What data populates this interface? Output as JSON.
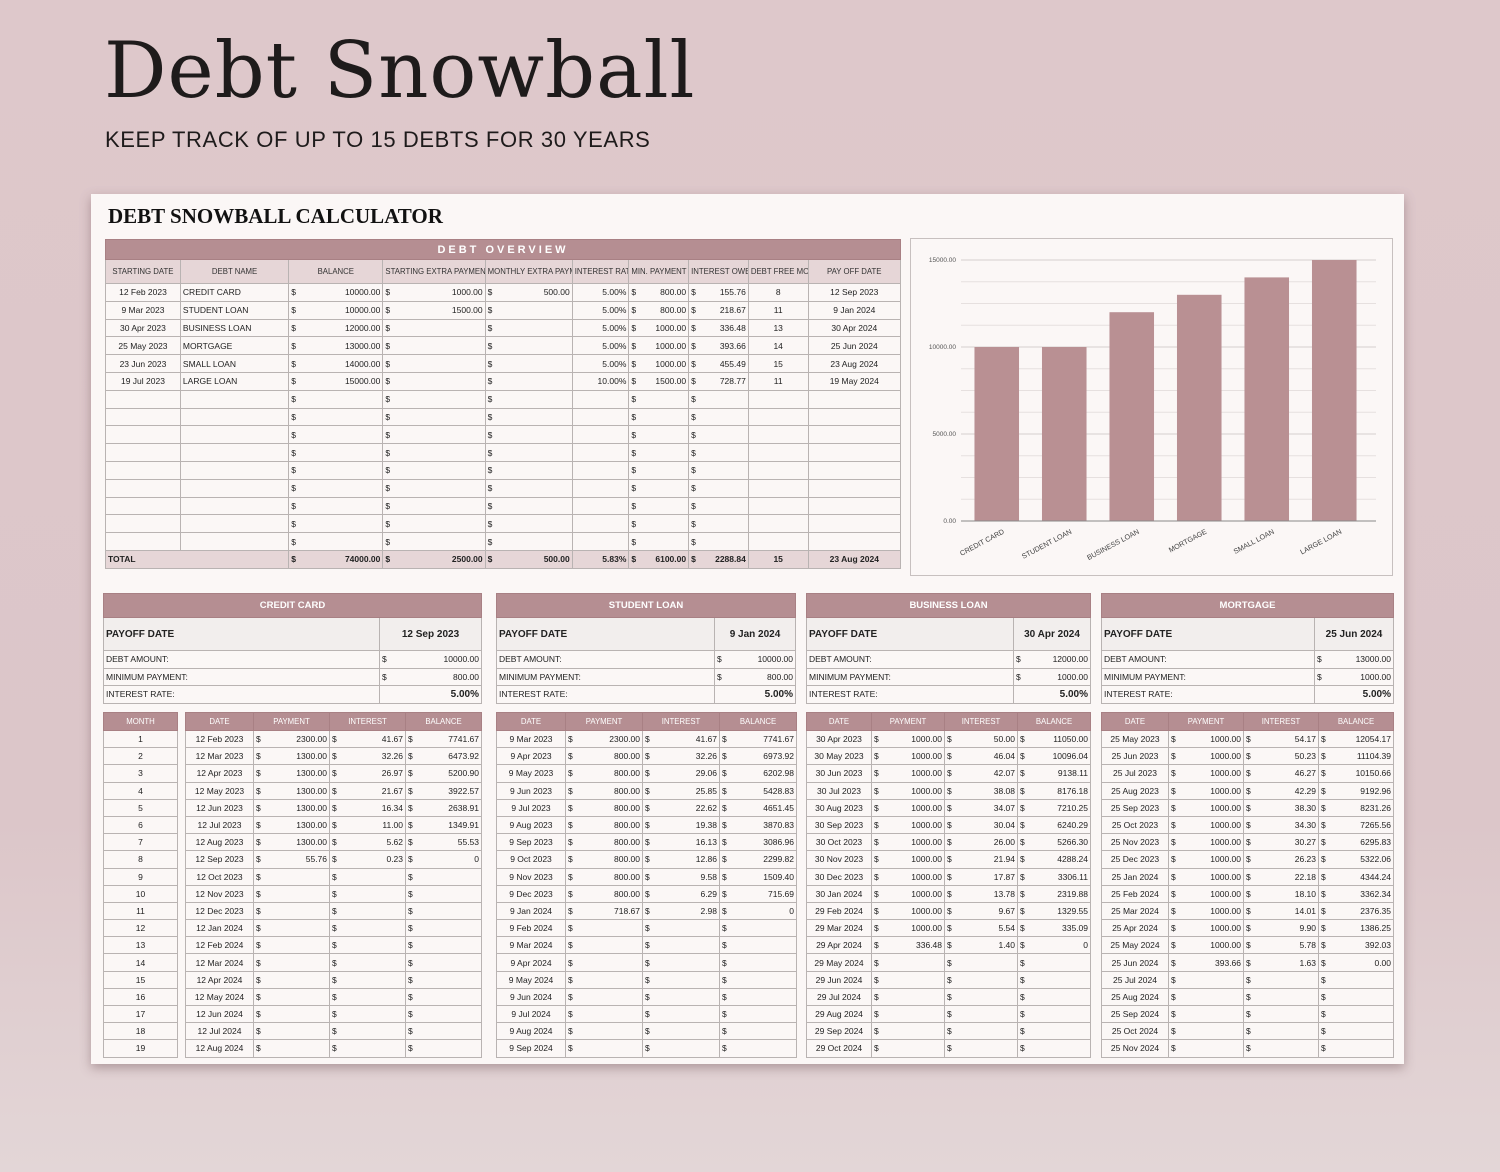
{
  "hero": {
    "title": "Debt Snowball",
    "subtitle": "KEEP TRACK OF UP TO 15 DEBTS FOR 30 YEARS"
  },
  "sheet": {
    "title": "DEBT SNOWBALL CALCULATOR",
    "accent_color": "#b58e92",
    "header_bg_color": "#e6d6d7"
  },
  "overview": {
    "band": "DEBT OVERVIEW",
    "headers": [
      "STARTING DATE",
      "DEBT NAME",
      "BALANCE",
      "STARTING EXTRA PAYMENT",
      "MONTHLY EXTRA PAYMENT",
      "INTEREST RATE",
      "MIN. PAYMENT",
      "INTEREST OWED",
      "DEBT FREE MONTH",
      "PAY OFF DATE"
    ],
    "currency": "$",
    "rows": [
      {
        "start": "12 Feb 2023",
        "name": "CREDIT CARD",
        "balance": "10000.00",
        "start_extra": "1000.00",
        "monthly_extra": "500.00",
        "rate": "5.00%",
        "min": "800.00",
        "interest": "155.76",
        "month": "8",
        "payoff": "12 Sep 2023"
      },
      {
        "start": "9 Mar 2023",
        "name": "STUDENT LOAN",
        "balance": "10000.00",
        "start_extra": "1500.00",
        "monthly_extra": "",
        "rate": "5.00%",
        "min": "800.00",
        "interest": "218.67",
        "month": "11",
        "payoff": "9 Jan 2024"
      },
      {
        "start": "30 Apr 2023",
        "name": "BUSINESS LOAN",
        "balance": "12000.00",
        "start_extra": "",
        "monthly_extra": "",
        "rate": "5.00%",
        "min": "1000.00",
        "interest": "336.48",
        "month": "13",
        "payoff": "30 Apr 2024"
      },
      {
        "start": "25 May 2023",
        "name": "MORTGAGE",
        "balance": "13000.00",
        "start_extra": "",
        "monthly_extra": "",
        "rate": "5.00%",
        "min": "1000.00",
        "interest": "393.66",
        "month": "14",
        "payoff": "25 Jun 2024"
      },
      {
        "start": "23 Jun 2023",
        "name": "SMALL LOAN",
        "balance": "14000.00",
        "start_extra": "",
        "monthly_extra": "",
        "rate": "5.00%",
        "min": "1000.00",
        "interest": "455.49",
        "month": "15",
        "payoff": "23 Aug 2024"
      },
      {
        "start": "19 Jul 2023",
        "name": "LARGE LOAN",
        "balance": "15000.00",
        "start_extra": "",
        "monthly_extra": "",
        "rate": "10.00%",
        "min": "1500.00",
        "interest": "728.77",
        "month": "11",
        "payoff": "19 May 2024"
      }
    ],
    "empty_rows": 9,
    "total": {
      "label": "TOTAL",
      "balance": "74000.00",
      "start_extra": "2500.00",
      "monthly_extra": "500.00",
      "rate": "5.83%",
      "min": "6100.00",
      "interest": "2288.84",
      "month": "15",
      "payoff": "23 Aug 2024"
    }
  },
  "chart_data": {
    "type": "bar",
    "title": "",
    "xlabel": "",
    "ylabel": "",
    "categories": [
      "CREDIT CARD",
      "STUDENT LOAN",
      "BUSINESS LOAN",
      "MORTGAGE",
      "SMALL LOAN",
      "LARGE LOAN"
    ],
    "values": [
      10000,
      10000,
      12000,
      13000,
      14000,
      15000
    ],
    "ylim": [
      0,
      15000
    ],
    "yticks": [
      "0.00",
      "5000.00",
      "10000.00",
      "15000.00"
    ],
    "grid": true,
    "bar_color": "#b99093"
  },
  "month_column": {
    "header": "MONTH",
    "values": [
      "1",
      "2",
      "3",
      "4",
      "5",
      "6",
      "7",
      "8",
      "9",
      "10",
      "11",
      "12",
      "13",
      "14",
      "15",
      "16",
      "17",
      "18",
      "19"
    ]
  },
  "debts": [
    {
      "name": "CREDIT CARD",
      "payoff_label": "PAYOFF DATE",
      "payoff": "12 Sep 2023",
      "amount_label": "DEBT AMOUNT:",
      "amount": "10000.00",
      "min_label": "MINIMUM PAYMENT:",
      "min": "800.00",
      "rate_label": "INTEREST RATE:",
      "rate": "5.00%",
      "schedule_headers": [
        "DATE",
        "PAYMENT",
        "INTEREST",
        "BALANCE"
      ],
      "schedule": [
        [
          "12 Feb 2023",
          "2300.00",
          "41.67",
          "7741.67"
        ],
        [
          "12 Mar 2023",
          "1300.00",
          "32.26",
          "6473.92"
        ],
        [
          "12 Apr 2023",
          "1300.00",
          "26.97",
          "5200.90"
        ],
        [
          "12 May 2023",
          "1300.00",
          "21.67",
          "3922.57"
        ],
        [
          "12 Jun 2023",
          "1300.00",
          "16.34",
          "2638.91"
        ],
        [
          "12 Jul 2023",
          "1300.00",
          "11.00",
          "1349.91"
        ],
        [
          "12 Aug 2023",
          "1300.00",
          "5.62",
          "55.53"
        ],
        [
          "12 Sep 2023",
          "55.76",
          "0.23",
          "0"
        ],
        [
          "12 Oct 2023",
          "",
          "",
          ""
        ],
        [
          "12 Nov 2023",
          "",
          "",
          ""
        ],
        [
          "12 Dec 2023",
          "",
          "",
          ""
        ],
        [
          "12 Jan 2024",
          "",
          "",
          ""
        ],
        [
          "12 Feb 2024",
          "",
          "",
          ""
        ],
        [
          "12 Mar 2024",
          "",
          "",
          ""
        ],
        [
          "12 Apr 2024",
          "",
          "",
          ""
        ],
        [
          "12 May 2024",
          "",
          "",
          ""
        ],
        [
          "12 Jun 2024",
          "",
          "",
          ""
        ],
        [
          "12 Jul 2024",
          "",
          "",
          ""
        ],
        [
          "12 Aug 2024",
          "",
          "",
          ""
        ]
      ]
    },
    {
      "name": "STUDENT LOAN",
      "payoff_label": "PAYOFF DATE",
      "payoff": "9 Jan 2024",
      "amount_label": "DEBT AMOUNT:",
      "amount": "10000.00",
      "min_label": "MINIMUM PAYMENT:",
      "min": "800.00",
      "rate_label": "INTEREST RATE:",
      "rate": "5.00%",
      "schedule_headers": [
        "DATE",
        "PAYMENT",
        "INTEREST",
        "BALANCE"
      ],
      "schedule": [
        [
          "9 Mar 2023",
          "2300.00",
          "41.67",
          "7741.67"
        ],
        [
          "9 Apr 2023",
          "800.00",
          "32.26",
          "6973.92"
        ],
        [
          "9 May 2023",
          "800.00",
          "29.06",
          "6202.98"
        ],
        [
          "9 Jun 2023",
          "800.00",
          "25.85",
          "5428.83"
        ],
        [
          "9 Jul 2023",
          "800.00",
          "22.62",
          "4651.45"
        ],
        [
          "9 Aug 2023",
          "800.00",
          "19.38",
          "3870.83"
        ],
        [
          "9 Sep 2023",
          "800.00",
          "16.13",
          "3086.96"
        ],
        [
          "9 Oct 2023",
          "800.00",
          "12.86",
          "2299.82"
        ],
        [
          "9 Nov 2023",
          "800.00",
          "9.58",
          "1509.40"
        ],
        [
          "9 Dec 2023",
          "800.00",
          "6.29",
          "715.69"
        ],
        [
          "9 Jan 2024",
          "718.67",
          "2.98",
          "0"
        ],
        [
          "9 Feb 2024",
          "",
          "",
          ""
        ],
        [
          "9 Mar 2024",
          "",
          "",
          ""
        ],
        [
          "9 Apr 2024",
          "",
          "",
          ""
        ],
        [
          "9 May 2024",
          "",
          "",
          ""
        ],
        [
          "9 Jun 2024",
          "",
          "",
          ""
        ],
        [
          "9 Jul 2024",
          "",
          "",
          ""
        ],
        [
          "9 Aug 2024",
          "",
          "",
          ""
        ],
        [
          "9 Sep 2024",
          "",
          "",
          ""
        ]
      ]
    },
    {
      "name": "BUSINESS LOAN",
      "payoff_label": "PAYOFF DATE",
      "payoff": "30 Apr 2024",
      "amount_label": "DEBT AMOUNT:",
      "amount": "12000.00",
      "min_label": "MINIMUM PAYMENT:",
      "min": "1000.00",
      "rate_label": "INTEREST RATE:",
      "rate": "5.00%",
      "schedule_headers": [
        "DATE",
        "PAYMENT",
        "INTEREST",
        "BALANCE"
      ],
      "schedule": [
        [
          "30 Apr 2023",
          "1000.00",
          "50.00",
          "11050.00"
        ],
        [
          "30 May 2023",
          "1000.00",
          "46.04",
          "10096.04"
        ],
        [
          "30 Jun 2023",
          "1000.00",
          "42.07",
          "9138.11"
        ],
        [
          "30 Jul 2023",
          "1000.00",
          "38.08",
          "8176.18"
        ],
        [
          "30 Aug 2023",
          "1000.00",
          "34.07",
          "7210.25"
        ],
        [
          "30 Sep 2023",
          "1000.00",
          "30.04",
          "6240.29"
        ],
        [
          "30 Oct 2023",
          "1000.00",
          "26.00",
          "5266.30"
        ],
        [
          "30 Nov 2023",
          "1000.00",
          "21.94",
          "4288.24"
        ],
        [
          "30 Dec 2023",
          "1000.00",
          "17.87",
          "3306.11"
        ],
        [
          "30 Jan 2024",
          "1000.00",
          "13.78",
          "2319.88"
        ],
        [
          "29 Feb 2024",
          "1000.00",
          "9.67",
          "1329.55"
        ],
        [
          "29 Mar 2024",
          "1000.00",
          "5.54",
          "335.09"
        ],
        [
          "29 Apr 2024",
          "336.48",
          "1.40",
          "0"
        ],
        [
          "29 May 2024",
          "",
          "",
          ""
        ],
        [
          "29 Jun 2024",
          "",
          "",
          ""
        ],
        [
          "29 Jul 2024",
          "",
          "",
          ""
        ],
        [
          "29 Aug 2024",
          "",
          "",
          ""
        ],
        [
          "29 Sep 2024",
          "",
          "",
          ""
        ],
        [
          "29 Oct 2024",
          "",
          "",
          ""
        ]
      ]
    },
    {
      "name": "MORTGAGE",
      "payoff_label": "PAYOFF DATE",
      "payoff": "25 Jun 2024",
      "amount_label": "DEBT AMOUNT:",
      "amount": "13000.00",
      "min_label": "MINIMUM PAYMENT:",
      "min": "1000.00",
      "rate_label": "INTEREST RATE:",
      "rate": "5.00%",
      "schedule_headers": [
        "DATE",
        "PAYMENT",
        "INTEREST",
        "BALANCE"
      ],
      "schedule": [
        [
          "25 May 2023",
          "1000.00",
          "54.17",
          "12054.17"
        ],
        [
          "25 Jun 2023",
          "1000.00",
          "50.23",
          "11104.39"
        ],
        [
          "25 Jul 2023",
          "1000.00",
          "46.27",
          "10150.66"
        ],
        [
          "25 Aug 2023",
          "1000.00",
          "42.29",
          "9192.96"
        ],
        [
          "25 Sep 2023",
          "1000.00",
          "38.30",
          "8231.26"
        ],
        [
          "25 Oct 2023",
          "1000.00",
          "34.30",
          "7265.56"
        ],
        [
          "25 Nov 2023",
          "1000.00",
          "30.27",
          "6295.83"
        ],
        [
          "25 Dec 2023",
          "1000.00",
          "26.23",
          "5322.06"
        ],
        [
          "25 Jan 2024",
          "1000.00",
          "22.18",
          "4344.24"
        ],
        [
          "25 Feb 2024",
          "1000.00",
          "18.10",
          "3362.34"
        ],
        [
          "25 Mar 2024",
          "1000.00",
          "14.01",
          "2376.35"
        ],
        [
          "25 Apr 2024",
          "1000.00",
          "9.90",
          "1386.25"
        ],
        [
          "25 May 2024",
          "1000.00",
          "5.78",
          "392.03"
        ],
        [
          "25 Jun 2024",
          "393.66",
          "1.63",
          "0.00"
        ],
        [
          "25 Jul 2024",
          "",
          "",
          ""
        ],
        [
          "25 Aug 2024",
          "",
          "",
          ""
        ],
        [
          "25 Sep 2024",
          "",
          "",
          ""
        ],
        [
          "25 Oct 2024",
          "",
          "",
          ""
        ],
        [
          "25 Nov 2024",
          "",
          "",
          ""
        ]
      ]
    }
  ]
}
